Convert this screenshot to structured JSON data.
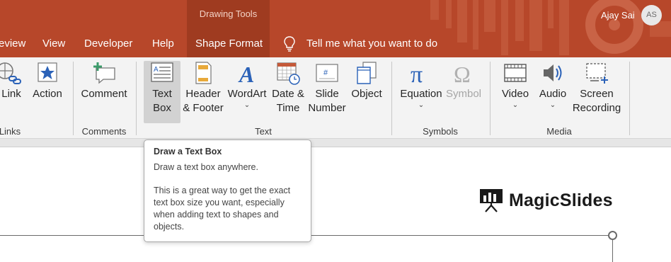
{
  "titlebar": {
    "context_group": "Drawing Tools",
    "user_name": "Ajay Sai",
    "avatar_initials": "AS",
    "tabs": [
      {
        "label": "eview"
      },
      {
        "label": "View"
      },
      {
        "label": "Developer"
      },
      {
        "label": "Help"
      },
      {
        "label": "Shape Format"
      }
    ],
    "tellme": "Tell me what you want to do",
    "accent_color": "#b7472a"
  },
  "ribbon": {
    "links": {
      "link": "Link",
      "action": "Action",
      "group": "Links"
    },
    "comments": {
      "comment": "Comment",
      "group": "Comments"
    },
    "text": {
      "textbox": [
        "Text",
        "Box"
      ],
      "header_footer": [
        "Header",
        "& Footer"
      ],
      "wordart": "WordArt",
      "date_time": [
        "Date &",
        "Time"
      ],
      "slide_number": [
        "Slide",
        "Number"
      ],
      "object": "Object",
      "group": "Text"
    },
    "symbols": {
      "equation": "Equation",
      "symbol": "Symbol",
      "group": "Symbols"
    },
    "media": {
      "video": "Video",
      "audio": "Audio",
      "screen_recording": [
        "Screen",
        "Recording"
      ],
      "group": "Media"
    }
  },
  "tooltip": {
    "title": "Draw a Text Box",
    "line1": "Draw a text box anywhere.",
    "para": [
      "This is a great way to get the exact",
      "text box size you want, especially",
      "when adding text to shapes and",
      "objects."
    ]
  },
  "slide": {
    "logo_text": "MagicSlides"
  }
}
